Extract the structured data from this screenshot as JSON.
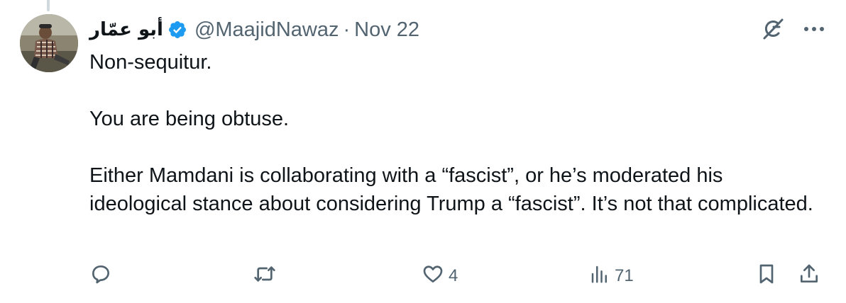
{
  "tweet": {
    "author": {
      "display_name": "أبو عمّار",
      "handle": "@MaajidNawaz",
      "verified": true,
      "avatar_icon": "profile-photo"
    },
    "separator": "·",
    "date": "Nov 22",
    "paragraphs": [
      "Non-sequitur.",
      "You are being obtuse.",
      "Either Mamdani is collaborating with a “fascist”, or he’s moderated his ideological stance about considering Trump a “fascist”. It’s not that complicated."
    ]
  },
  "top_actions": [
    {
      "icon": "grok-icon"
    },
    {
      "icon": "more-icon"
    }
  ],
  "actions": {
    "reply": {
      "icon": "reply-icon",
      "count": ""
    },
    "retweet": {
      "icon": "retweet-icon",
      "count": ""
    },
    "like": {
      "icon": "like-icon",
      "count": "4"
    },
    "views": {
      "icon": "views-icon",
      "count": "71"
    },
    "bookmark": {
      "icon": "bookmark-icon"
    },
    "share": {
      "icon": "share-icon"
    }
  },
  "colors": {
    "text": "#0f1419",
    "secondary": "#536471",
    "verified_blue": "#1d9bf0",
    "thread_line": "#cfd9de"
  }
}
